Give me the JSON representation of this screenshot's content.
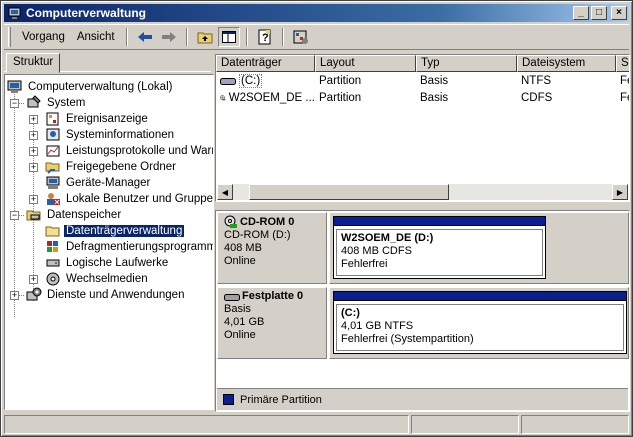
{
  "window": {
    "title": "Computerverwaltung",
    "minimize": "_",
    "maximize": "□",
    "close": "×"
  },
  "menu": {
    "action": "Vorgang",
    "view": "Ansicht"
  },
  "toolbar": {
    "icons": [
      "back-icon",
      "forward-icon",
      "up-folder-icon",
      "show-hide-tree-icon",
      "help-icon",
      "properties-icon"
    ]
  },
  "tree": {
    "tab_label": "Struktur",
    "root": "Computerverwaltung (Lokal)",
    "system": "System",
    "event_viewer": "Ereignisanzeige",
    "system_info": "Systeminformationen",
    "perf_logs": "Leistungsprotokolle und Warn",
    "shared_folders": "Freigegebene Ordner",
    "device_manager": "Geräte-Manager",
    "local_users": "Lokale Benutzer und Gruppen",
    "storage": "Datenspeicher",
    "disk_management": "Datenträgerverwaltung",
    "defrag": "Defragmentierungsprogramm",
    "logical_drives": "Logische Laufwerke",
    "removable": "Wechselmedien",
    "services": "Dienste und Anwendungen"
  },
  "volume_list": {
    "columns": [
      "Datenträger",
      "Layout",
      "Typ",
      "Dateisystem",
      "St"
    ],
    "rows": [
      {
        "volume": "(C:)",
        "layout": "Partition",
        "type": "Basis",
        "fs": "NTFS",
        "status": "Fe"
      },
      {
        "volume": "W2SOEM_DE ...",
        "layout": "Partition",
        "type": "Basis",
        "fs": "CDFS",
        "status": "Fe"
      }
    ]
  },
  "disks": [
    {
      "name": "CD-ROM 0",
      "line1": "CD-ROM (D:)",
      "line2": "408 MB",
      "line3": "Online",
      "partition": {
        "name": "W2SOEM_DE  (D:)",
        "size": "408 MB CDFS",
        "status": "Fehlerfrei"
      }
    },
    {
      "name": "Festplatte 0",
      "line1": "Basis",
      "line2": "4,01 GB",
      "line3": "Online",
      "partition": {
        "name": "(C:)",
        "size": "4,01 GB NTFS",
        "status": "Fehlerfrei (Systempartition)"
      }
    }
  ],
  "legend": {
    "label": "Primäre Partition",
    "color": "#0a1e8c"
  },
  "colors": {
    "title_start": "#0a246a",
    "title_end": "#a6caf0",
    "selection": "#0a246a",
    "face": "#d4d0c8"
  }
}
